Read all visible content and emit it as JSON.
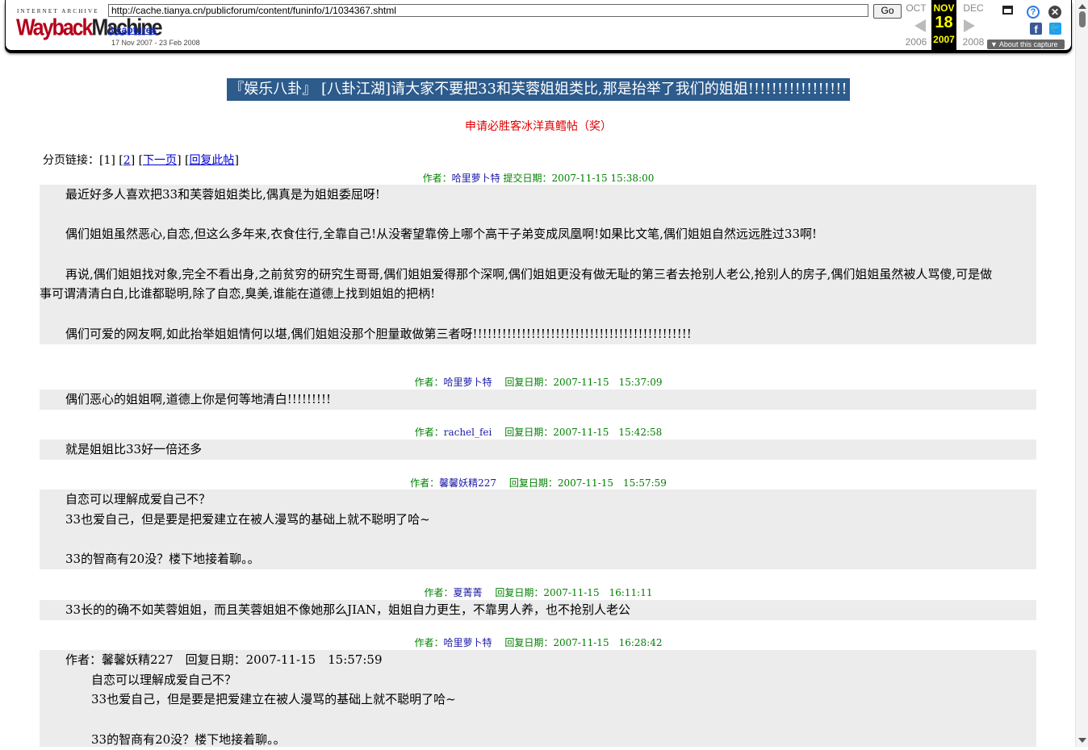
{
  "wayback": {
    "logo_top": "INTERNET ARCHIVE",
    "logo_main_1": "Wayback",
    "logo_main_2": "Machine",
    "url": "http://cache.tianya.cn/publicforum/content/funinfo/1/1034367.shtml",
    "go_label": "Go",
    "captures": "3 captures",
    "range": "17 Nov 2007 - 23 Feb 2008",
    "prev_month": "OCT",
    "cur_month": "NOV",
    "next_month": "DEC",
    "cur_day": "18",
    "prev_year": "2006",
    "cur_year": "2007",
    "next_year": "2008",
    "about": "About this capture"
  },
  "title": "『娱乐八卦』 [八卦江湖]请大家不要把33和芙蓉姐姐类比,那是抬举了我们的姐姐!!!!!!!!!!!!!!!!!",
  "award": "申请必胜客冰洋真鳕帖（奖）",
  "pager": {
    "label": "分页链接：",
    "page1": "[1]",
    "page2": "2",
    "next": "下一页",
    "reply": "回复此帖"
  },
  "posts": [
    {
      "author_label": "作者：",
      "author": "哈里萝卜特",
      "date_label": "提交日期：",
      "date": "2007-11-15 15:38:00",
      "lines": [
        "最近好多人喜欢把33和芙蓉姐姐类比,偶真是为姐姐委屈呀!",
        "偶们姐姐虽然恶心,自恋,但这么多年来,衣食住行,全靠自己!从没奢望靠傍上哪个高干子弟变成凤凰啊!如果比文笔,偶们姐姐自然远远胜过33啊!",
        "再说,偶们姐姐找对象,完全不看出身,之前贫穷的研究生哥哥,偶们姐姐爱得那个深啊,偶们姐姐更没有做无耻的第三者去抢别人老公,抢别人的房子,偶们姐姐虽然被人骂傻,可是做",
        "事可谓清清白白,比谁都聪明,除了自恋,臭美,谁能在道德上找到姐姐的把柄!",
        "偶们可爱的网友啊,如此抬举姐姐情何以堪,偶们姐姐没那个胆量敢做第三者呀!!!!!!!!!!!!!!!!!!!!!!!!!!!!!!!!!!!!!!!!!!!!!"
      ]
    },
    {
      "author_label": "作者：",
      "author": "哈里萝卜特",
      "date_label": "回复日期：",
      "date": "2007-11-15　15:37:09",
      "lines": [
        "偶们恶心的姐姐啊,道德上你是何等地清白!!!!!!!!!"
      ]
    },
    {
      "author_label": "作者：",
      "author": "rachel_fei",
      "date_label": "回复日期：",
      "date": "2007-11-15　15:42:58",
      "lines": [
        "就是姐姐比33好一倍还多"
      ]
    },
    {
      "author_label": "作者：",
      "author": "馨馨妖精227",
      "date_label": "回复日期：",
      "date": "2007-11-15　15:57:59",
      "lines": [
        "自恋可以理解成爱自己不？",
        "33也爱自己，但是要是把爱建立在被人漫骂的基础上就不聪明了哈~",
        "33的智商有20没？楼下地接着聊。。"
      ]
    },
    {
      "author_label": "作者：",
      "author": "夏菁菁",
      "date_label": "回复日期：",
      "date": "2007-11-15　16:11:11",
      "lines": [
        "33长的的确不如芙蓉姐姐，而且芙蓉姐姐不像她那么JIAN，姐姐自力更生，不靠男人养，也不抢别人老公"
      ]
    },
    {
      "author_label": "作者：",
      "author": "哈里萝卜特",
      "date_label": "回复日期：",
      "date": "2007-11-15　16:28:42",
      "quote_header": "作者：馨馨妖精227　回复日期：2007-11-15　15:57:59",
      "lines": [
        "自恋可以理解成爱自己不？",
        "33也爱自己，但是要是把爱建立在被人漫骂的基础上就不聪明了哈~",
        "33的智商有20没？楼下地接着聊。。"
      ]
    }
  ]
}
